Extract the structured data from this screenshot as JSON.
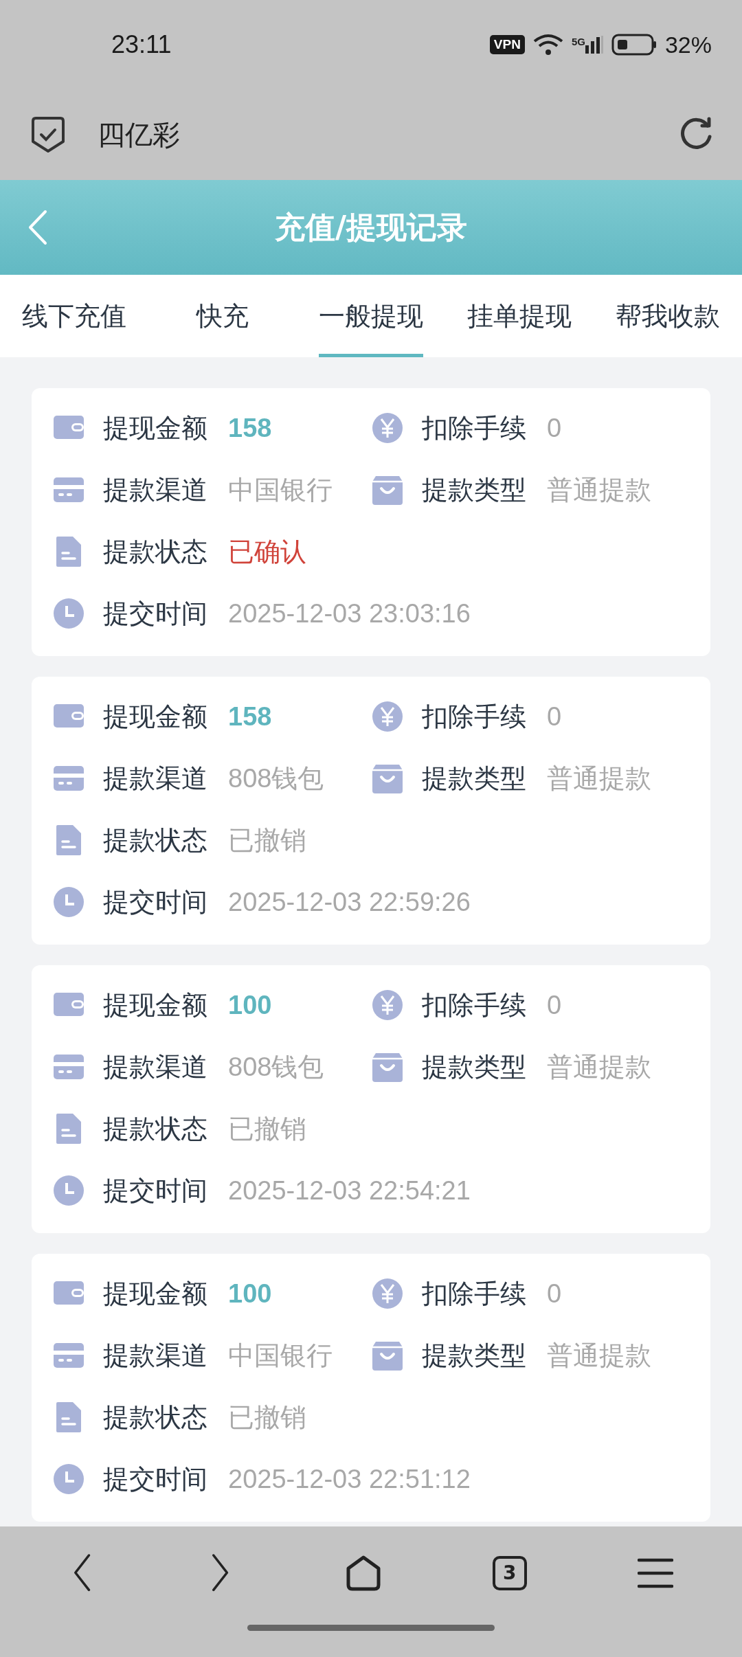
{
  "status_bar": {
    "time": "23:11",
    "vpn": "VPN",
    "network": "5G",
    "battery": "32%"
  },
  "browser": {
    "title": "四亿彩"
  },
  "header": {
    "title": "充值/提现记录"
  },
  "tabs": [
    {
      "label": "线下充值",
      "selected": false
    },
    {
      "label": "快充",
      "selected": false
    },
    {
      "label": "一般提现",
      "selected": true
    },
    {
      "label": "挂单提现",
      "selected": false
    },
    {
      "label": "帮我收款",
      "selected": false
    }
  ],
  "records": [
    {
      "amount_label": "提现金额",
      "amount": "158",
      "fee_label": "扣除手续",
      "fee": "0",
      "channel_label": "提款渠道",
      "channel": "中国银行",
      "type_label": "提款类型",
      "type": "普通提款",
      "status_label": "提款状态",
      "status": "已确认",
      "confirmed": true,
      "time_label": "提交时间",
      "time": "2025-12-03 23:03:16"
    },
    {
      "amount_label": "提现金额",
      "amount": "158",
      "fee_label": "扣除手续",
      "fee": "0",
      "channel_label": "提款渠道",
      "channel": "808钱包",
      "type_label": "提款类型",
      "type": "普通提款",
      "status_label": "提款状态",
      "status": "已撤销",
      "confirmed": false,
      "time_label": "提交时间",
      "time": "2025-12-03 22:59:26"
    },
    {
      "amount_label": "提现金额",
      "amount": "100",
      "fee_label": "扣除手续",
      "fee": "0",
      "channel_label": "提款渠道",
      "channel": "808钱包",
      "type_label": "提款类型",
      "type": "普通提款",
      "status_label": "提款状态",
      "status": "已撤销",
      "confirmed": false,
      "time_label": "提交时间",
      "time": "2025-12-03 22:54:21"
    },
    {
      "amount_label": "提现金额",
      "amount": "100",
      "fee_label": "扣除手续",
      "fee": "0",
      "channel_label": "提款渠道",
      "channel": "中国银行",
      "type_label": "提款类型",
      "type": "普通提款",
      "status_label": "提款状态",
      "status": "已撤销",
      "confirmed": false,
      "time_label": "提交时间",
      "time": "2025-12-03 22:51:12"
    }
  ],
  "nav": {
    "tab_count": "3"
  }
}
